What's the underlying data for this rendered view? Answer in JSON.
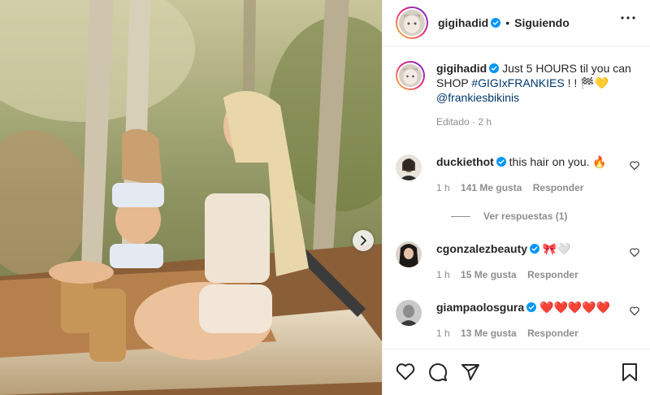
{
  "header": {
    "username": "gigihadid",
    "separator": "•",
    "follow_status": "Siguiendo",
    "more_icon": "more-horizontal-icon"
  },
  "caption": {
    "username": "gigihadid",
    "text_main": "Just 5 HOURS til you can SHOP",
    "hashtag": "#GIGIxFRANKIES",
    "text_tail": "! ! 🏁💛",
    "mention": "@frankiesbikinis",
    "edited_label": "Editado · 2 h"
  },
  "comments": [
    {
      "username": "duckiethot",
      "text": "this hair on you. 🔥",
      "time": "1 h",
      "likes": "141 Me gusta",
      "reply": "Responder",
      "view_replies": "Ver respuestas (1)"
    },
    {
      "username": "cgonzalezbeauty",
      "text": "🎀🤍",
      "time": "1 h",
      "likes": "15 Me gusta",
      "reply": "Responder"
    },
    {
      "username": "giampaolosgura",
      "text": "❤️❤️❤️❤️❤️",
      "time": "1 h",
      "likes": "13 Me gusta",
      "reply": "Responder"
    }
  ],
  "actions": {
    "like_icon": "heart-icon",
    "comment_icon": "comment-icon",
    "share_icon": "share-icon",
    "save_icon": "bookmark-icon"
  },
  "media": {
    "next_icon": "chevron-right-icon"
  },
  "colors": {
    "verified": "#0095f6",
    "link": "#00376b",
    "secondary_text": "#8e8e8e",
    "border": "#efefef"
  }
}
